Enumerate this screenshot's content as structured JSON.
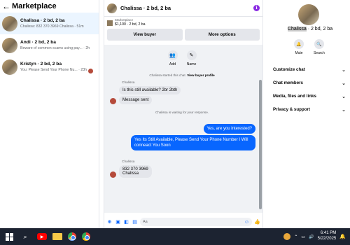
{
  "left": {
    "title": "Marketplace",
    "conversations": [
      {
        "name": "Chalissa · 2 bd, 2 ba",
        "snippet": "Chalissa: 832 370 3969 Chalissa · 51m"
      },
      {
        "name": "Andi · 2 bd, 2 ba",
        "snippet": "Beware of common scams using pay... · 2h"
      },
      {
        "name": "Kristyn · 2 bd, 2 ba",
        "snippet": "You: Please Send Your Phone Nu... · 23h"
      }
    ]
  },
  "chat": {
    "header_name": "Chalissa · 2 bd, 2 ba",
    "listing_label": "Marketplace",
    "listing_price": "$1,100 · 2 bd, 2 ba",
    "view_buyer": "View buyer",
    "more_options": "More options",
    "actions": [
      {
        "label": "Add"
      },
      {
        "label": "Name"
      }
    ],
    "sys_started": "Chalissa started this chat.",
    "sys_started_link": "View buyer profile",
    "sender1": "Chalissa",
    "msg1": "Is this still available? 2br 2bth",
    "msg2": "Message sent",
    "sys_waiting": "Chalissa is waiting for your response.",
    "out1": "Yes, are you interested?",
    "out2": "Yes Its Still Available, Please Send Your Phone Number I Will conneact You Soon",
    "sender2": "Chalissa",
    "msg3_line1": "832 370 3969",
    "msg3_line2": "Chalissa",
    "composer_placeholder": "Aa"
  },
  "right": {
    "name_highlight": "Chalissa",
    "name_rest": " · 2 bd, 2 ba",
    "mute": "Mute",
    "search": "Search",
    "menu": [
      "Customize chat",
      "Chat members",
      "Media, files and links",
      "Privacy & support"
    ]
  },
  "taskbar": {
    "time": "6:41 PM",
    "date": "5/22/2025"
  }
}
